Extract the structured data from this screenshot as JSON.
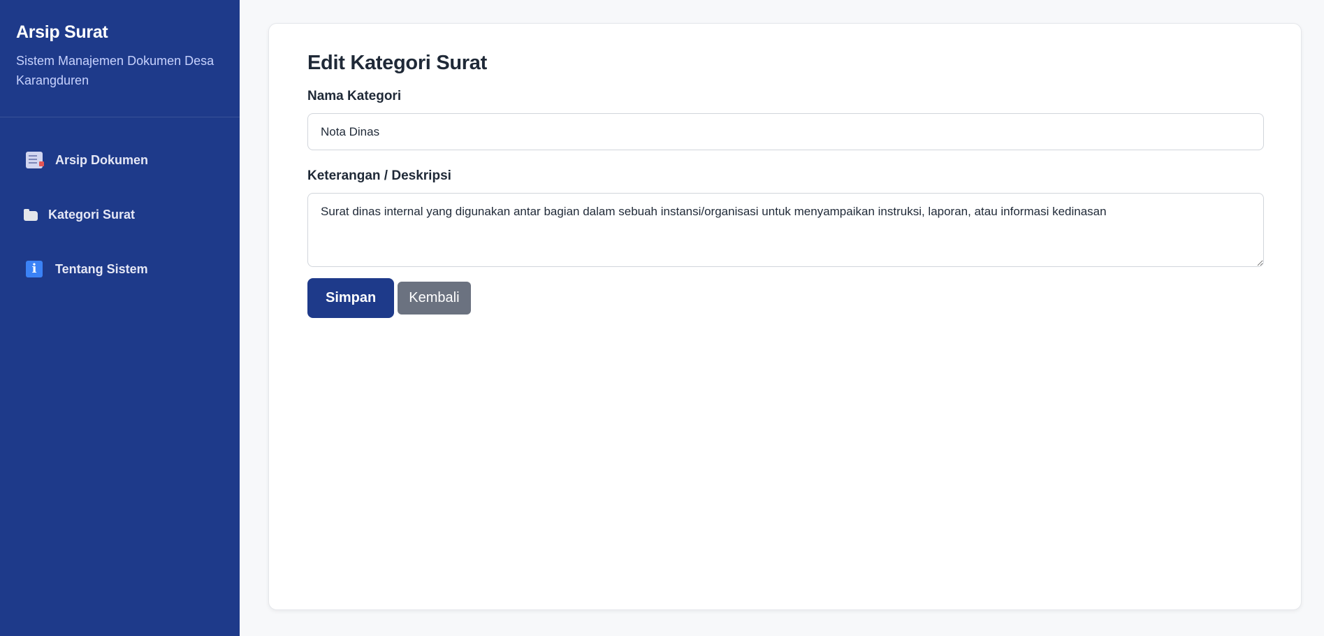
{
  "sidebar": {
    "app_title": "Arsip Surat",
    "app_subtitle": "Sistem Manajemen Dokumen Desa Karangduren",
    "items": [
      {
        "label": "Arsip Dokumen",
        "icon": "document-icon"
      },
      {
        "label": "Kategori Surat",
        "icon": "folder-icon"
      },
      {
        "label": "Tentang Sistem",
        "icon": "info-icon"
      }
    ]
  },
  "main": {
    "title": "Edit Kategori Surat",
    "form": {
      "name_label": "Nama Kategori",
      "name_value": "Nota Dinas",
      "description_label": "Keterangan / Deskripsi",
      "description_value": "Surat dinas internal yang digunakan antar bagian dalam sebuah instansi/organisasi untuk menyampaikan instruksi, laporan, atau informasi kedinasan"
    },
    "actions": {
      "save_label": "Simpan",
      "back_label": "Kembali"
    }
  },
  "colors": {
    "sidebar_bg": "#1e3a8a",
    "primary": "#1e3a8a",
    "secondary": "#6b7280",
    "page_bg": "#f7f8fa"
  }
}
